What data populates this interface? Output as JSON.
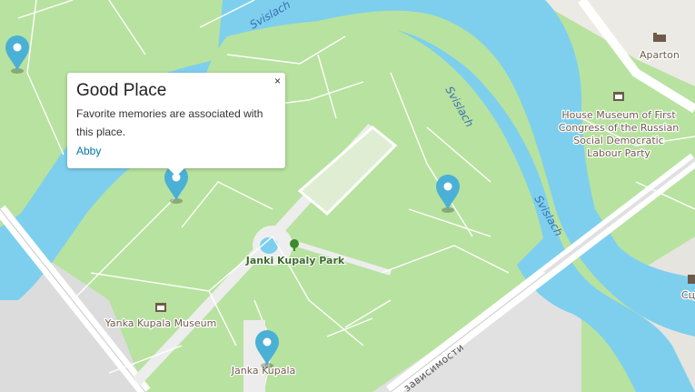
{
  "map": {
    "labels": {
      "river_1": "Svislach",
      "river_2": "Svislach",
      "river_3": "Svislach",
      "aparton": "Aparton",
      "house_museum_1": "House Museum of First",
      "house_museum_2": "Congress of the Russian",
      "house_museum_3": "Social Democratic",
      "house_museum_4": "Labour Party",
      "park": "Janki Kupaly Park",
      "yanka_museum": "Yanka Kupala Museum",
      "janka_kupala": "Janka Kupala",
      "avenue": "зависимости",
      "edge_label": "Сц"
    },
    "colors": {
      "park": "#b8e29f",
      "water": "#7ecfee",
      "path": "#ffffff",
      "pin": "#4bb0d6",
      "urban": "#e8e6e1"
    }
  },
  "popup": {
    "title": "Good Place",
    "description": "Favorite memories are associated with this place.",
    "link": "Abby",
    "close": "×"
  },
  "markers": [
    {
      "icon": "map-pin-icon"
    },
    {
      "icon": "map-pin-icon"
    },
    {
      "icon": "map-pin-icon"
    },
    {
      "icon": "map-pin-icon"
    }
  ]
}
